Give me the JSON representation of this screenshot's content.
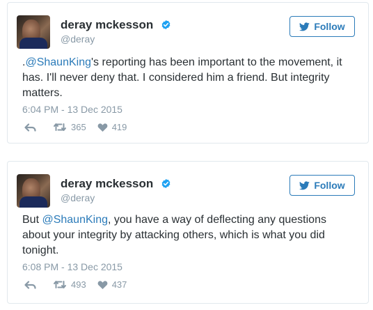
{
  "tweets": [
    {
      "name": "deray mckesson",
      "handle": "@deray",
      "follow_label": "Follow",
      "text_before": ".",
      "mention": "@ShaunKing",
      "text_after": "'s reporting has been important to the movement, it has. I'll never deny that. I considered him a friend. But integrity matters.",
      "timestamp": "6:04 PM - 13 Dec 2015",
      "retweets": "365",
      "likes": "419"
    },
    {
      "name": "deray mckesson",
      "handle": "@deray",
      "follow_label": "Follow",
      "text_before": "But ",
      "mention": "@ShaunKing",
      "text_after": ", you have a way of deflecting any questions about your integrity by attacking others, which is what you did tonight.",
      "timestamp": "6:08 PM - 13 Dec 2015",
      "retweets": "493",
      "likes": "437"
    }
  ],
  "colors": {
    "link": "#2b7bb9",
    "muted": "#8899a6",
    "text": "#292f33",
    "verified": "#1da1f2",
    "border": "#e1e8ed"
  },
  "icons": [
    "verified-badge-icon",
    "bird-icon",
    "reply-icon",
    "retweet-icon",
    "heart-icon"
  ]
}
